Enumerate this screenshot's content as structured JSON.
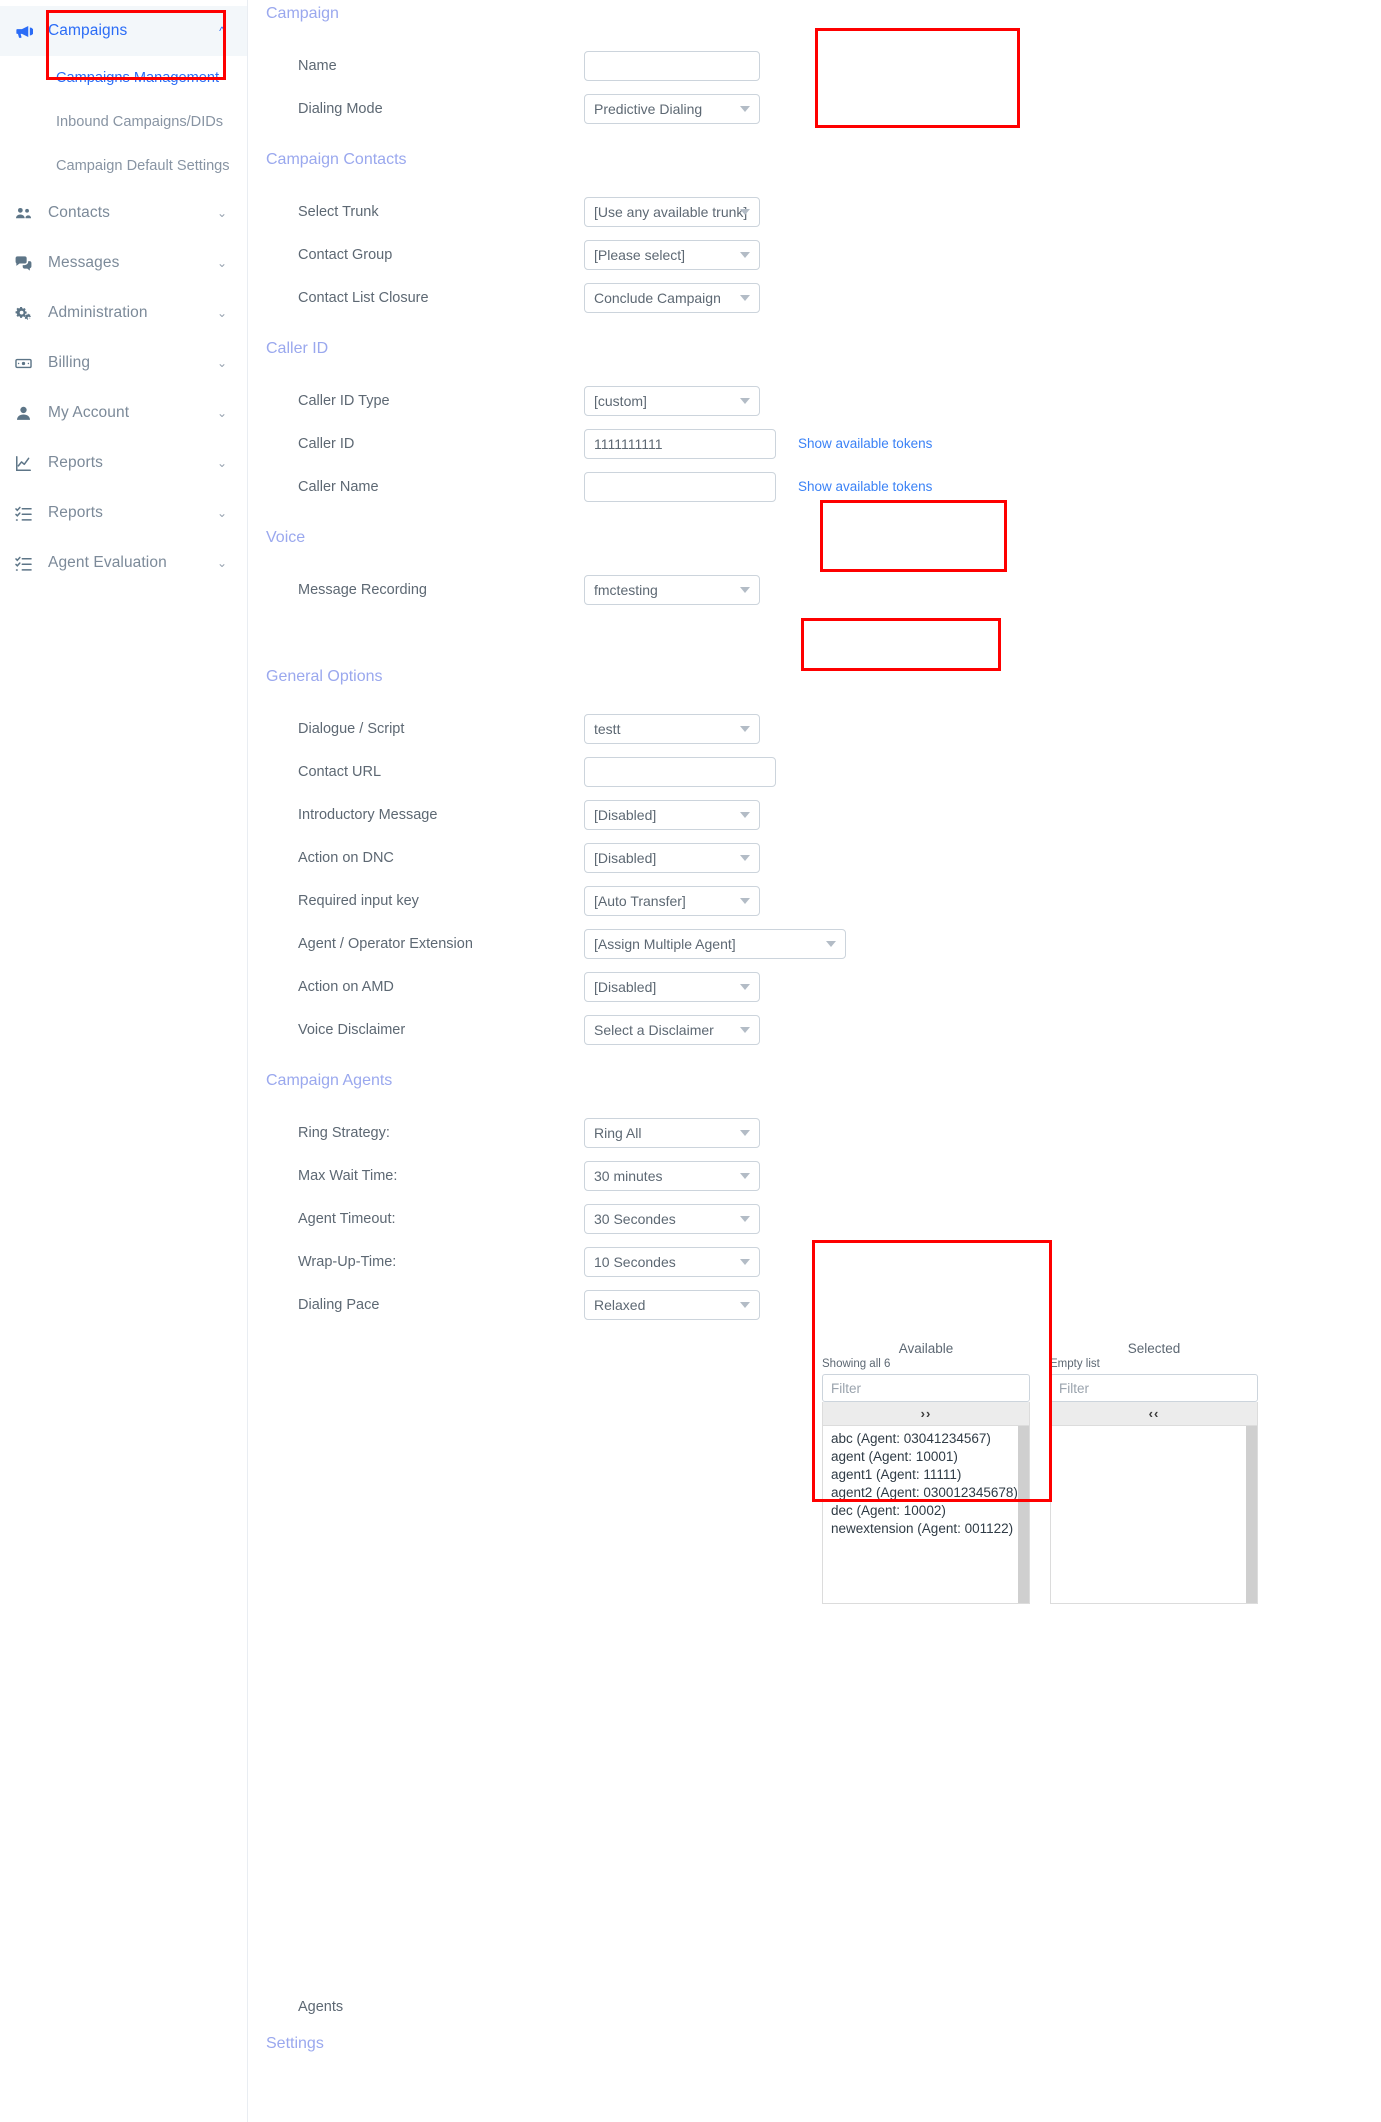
{
  "sidebar": {
    "items": [
      {
        "label": "Campaigns",
        "icon": "megaphone-icon",
        "chevron": "^",
        "state": "expanded",
        "highlighted": true,
        "children": [
          {
            "label": "Campaigns Management",
            "highlighted": true
          },
          {
            "label": "Inbound Campaigns/DIDs",
            "highlighted": false
          },
          {
            "label": "Campaign Default Settings",
            "highlighted": false
          }
        ]
      },
      {
        "label": "Contacts",
        "icon": "people-icon",
        "chevron": "v"
      },
      {
        "label": "Messages",
        "icon": "chat-icon",
        "chevron": "v"
      },
      {
        "label": "Administration",
        "icon": "gears-icon",
        "chevron": "v"
      },
      {
        "label": "Billing",
        "icon": "banknote-icon",
        "chevron": "v"
      },
      {
        "label": "My Account",
        "icon": "user-icon",
        "chevron": "v"
      },
      {
        "label": "Reports",
        "icon": "chart-line-icon",
        "chevron": "v"
      },
      {
        "label": "Reports",
        "icon": "checklist-icon",
        "chevron": "v"
      },
      {
        "label": "Agent Evaluation",
        "icon": "checklist-icon",
        "chevron": "v"
      }
    ]
  },
  "form": {
    "sections": {
      "campaign": "Campaign",
      "campaign_contacts": "Campaign Contacts",
      "caller_id": "Caller ID",
      "voice": "Voice",
      "general_options": "General Options",
      "campaign_agents": "Campaign Agents",
      "settings": "Settings"
    },
    "fields": {
      "name": {
        "label": "Name",
        "value": "",
        "placeholder": ""
      },
      "dialing_mode": {
        "label": "Dialing Mode",
        "value": "Predictive Dialing"
      },
      "select_trunk": {
        "label": "Select Trunk",
        "value": "[Use any available trunk]"
      },
      "contact_group": {
        "label": "Contact Group",
        "value": "[Please select]"
      },
      "contact_list_closure": {
        "label": "Contact List Closure",
        "value": "Conclude Campaign"
      },
      "caller_id_type": {
        "label": "Caller ID Type",
        "value": "[custom]"
      },
      "caller_id": {
        "label": "Caller ID",
        "value": "1111111111",
        "token_link": "Show available tokens"
      },
      "caller_name": {
        "label": "Caller Name",
        "value": "",
        "token_link": "Show available tokens"
      },
      "message_recording": {
        "label": "Message Recording",
        "value": "fmctesting"
      },
      "dialogue_script": {
        "label": "Dialogue / Script",
        "value": "testt"
      },
      "contact_url": {
        "label": "Contact URL",
        "value": "",
        "placeholder": ""
      },
      "introductory_message": {
        "label": "Introductory Message",
        "value": "[Disabled]"
      },
      "action_on_dnc": {
        "label": "Action on DNC",
        "value": "[Disabled]"
      },
      "required_input_key": {
        "label": "Required input key",
        "value": "[Auto Transfer]"
      },
      "agent_operator_extension": {
        "label": "Agent / Operator Extension",
        "value": "[Assign Multiple Agent]"
      },
      "action_on_amd": {
        "label": "Action on AMD",
        "value": "[Disabled]"
      },
      "voice_disclaimer": {
        "label": "Voice Disclaimer",
        "value": "Select a Disclaimer"
      },
      "ring_strategy": {
        "label": "Ring Strategy:",
        "value": "Ring All"
      },
      "max_wait_time": {
        "label": "Max Wait Time:",
        "value": "30 minutes"
      },
      "agent_timeout": {
        "label": "Agent Timeout:",
        "value": "30 Secondes"
      },
      "wrap_up_time": {
        "label": "Wrap-Up-Time:",
        "value": "10 Secondes"
      },
      "dialing_pace": {
        "label": "Dialing Pace",
        "value": "Relaxed"
      },
      "agents": {
        "label": "Agents"
      }
    },
    "agent_picker": {
      "available": {
        "title": "Available",
        "count_text": "Showing all 6",
        "filter_placeholder": "Filter",
        "move_label": "››",
        "items": [
          "abc (Agent: 03041234567)",
          "agent (Agent: 10001)",
          "agent1 (Agent: 11111)",
          "agent2 (Agent: 030012345678)",
          "dec (Agent: 10002)",
          "newextension (Agent: 001122)"
        ]
      },
      "selected": {
        "title": "Selected",
        "count_text": "Empty list",
        "filter_placeholder": "Filter",
        "move_label": "‹‹",
        "items": []
      }
    }
  },
  "colors": {
    "accent_blue": "#2b6cf6",
    "section_header": "#9aa8ee",
    "highlight_red": "#fe0000",
    "link_blue": "#3b82f6"
  }
}
